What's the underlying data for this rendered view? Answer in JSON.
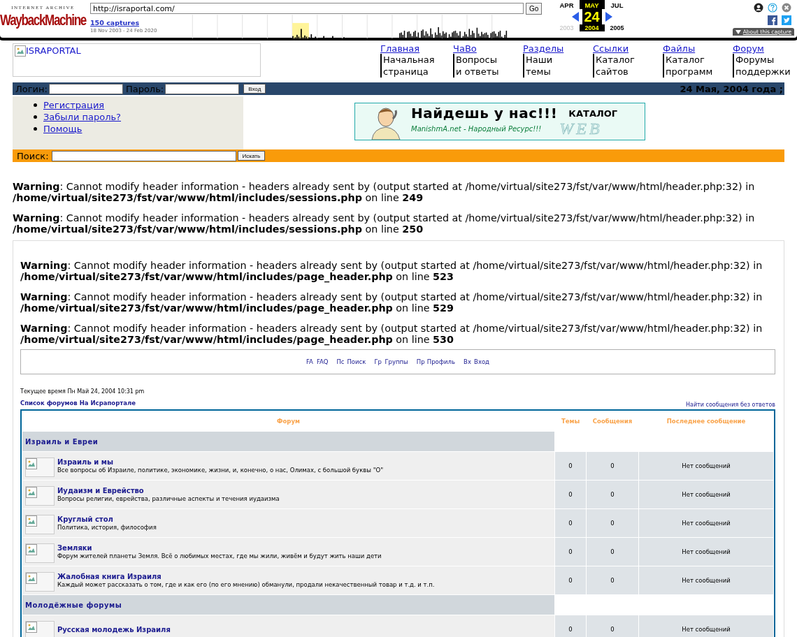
{
  "wayback": {
    "logo_top": "INTERNET ARCHIVE",
    "logo_main": "WaybackMachine",
    "url": "http://israportal.com/",
    "go": "Go",
    "captures": "150 captures",
    "date_range": "18 Nov 2003 - 24 Feb 2020",
    "months": [
      {
        "label": "APR",
        "selected": false
      },
      {
        "label": "MAY",
        "selected": true
      },
      {
        "label": "JUL",
        "selected": false
      }
    ],
    "day": "24",
    "years": [
      {
        "label": "2003",
        "selected": false
      },
      {
        "label": "2004",
        "selected": true
      },
      {
        "label": "2005",
        "selected": false
      }
    ],
    "about": "About this capture"
  },
  "header": {
    "logo_alt": "ISRAPORTAL",
    "nav": [
      {
        "title": "Главная",
        "subtitle": "Начальная страница"
      },
      {
        "title": "ЧаВо",
        "subtitle": "Вопросы и ответы"
      },
      {
        "title": "Разделы",
        "subtitle": "Наши темы"
      },
      {
        "title": "Ссылки",
        "subtitle": "Каталог сайтов"
      },
      {
        "title": "Файлы",
        "subtitle": "Каталог программ"
      },
      {
        "title": "Форум",
        "subtitle": "Форумы поддержки"
      }
    ]
  },
  "login": {
    "login_label": "Логин:",
    "password_label": "Пароль:",
    "submit": "Вход",
    "date": "24 Мая, 2004 года ;"
  },
  "side_links": [
    "Регистрация",
    "Забыли пароль?",
    "Помощь"
  ],
  "banner": {
    "headline": "Найдешь у нас!!!",
    "catalog": "КАТАЛОГ",
    "web": "WEB",
    "subtitle": "ManishmA.net - Народный Ресурс!!!"
  },
  "search": {
    "label": "Поиск:",
    "button": "Искать"
  },
  "warnings": [
    "**Warning**: Cannot modify header information - headers already sent by (output started at /home/virtual/site273/fst/var/www/html/header.php:32) in **/home/virtual/site273/fst/var/www/html/includes/sessions.php** on line **249**",
    "**Warning**: Cannot modify header information - headers already sent by (output started at /home/virtual/site273/fst/var/www/html/header.php:32) in **/home/virtual/site273/fst/var/www/html/includes/sessions.php** on line **250**"
  ],
  "forum_page": {
    "warnings": [
      "**Warning**: Cannot modify header information - headers already sent by (output started at /home/virtual/site273/fst/var/www/html/header.php:32) in **/home/virtual/site273/fst/var/www/html/includes/page_header.php** on line **523**",
      "**Warning**: Cannot modify header information - headers already sent by (output started at /home/virtual/site273/fst/var/www/html/header.php:32) in **/home/virtual/site273/fst/var/www/html/includes/page_header.php** on line **529**",
      "**Warning**: Cannot modify header information - headers already sent by (output started at /home/virtual/site273/fst/var/www/html/header.php:32) in **/home/virtual/site273/fst/var/www/html/includes/page_header.php** on line **530**"
    ],
    "nav": [
      {
        "icon_alt": "FA",
        "label": "FAQ"
      },
      {
        "icon_alt": "Пс",
        "label": "Поиск"
      },
      {
        "icon_alt": "Гр",
        "label": "Группы"
      },
      {
        "icon_alt": "Пр",
        "label": "Профиль"
      },
      {
        "icon_alt": "Вх",
        "label": "Вход"
      }
    ],
    "current_time": "Текущее время Пн Май 24, 2004 10:31 pm",
    "breadcrumb": "Список форумов На Исрапортале",
    "unanswered": "Найти сообщения без ответов",
    "table": {
      "columns": [
        "Форум",
        "Темы",
        "Сообщения",
        "Последнее сообщение"
      ],
      "sections": [
        {
          "title": "Израиль и Евреи",
          "forums": [
            {
              "title": "Израиль и мы",
              "description": "Все вопросы об Израиле, политике, экономике, жизни, и, конечно, о нас, Олимах, с большой буквы \"О\"",
              "topics": "0",
              "posts": "0",
              "last": "Нет сообщений"
            },
            {
              "title": "Иудаизм и Еврейство",
              "description": "Вопросы религии, еврейства, различные аспекты и течения иудаизма",
              "topics": "0",
              "posts": "0",
              "last": "Нет сообщений"
            },
            {
              "title": "Круглый стол",
              "description": "Политика, история, философия",
              "topics": "0",
              "posts": "0",
              "last": "Нет сообщений"
            },
            {
              "title": "Земляки",
              "description": "Форум жителей планеты Земля. Всё о любимых местах, где мы жили, живём и будут жить наши дети",
              "topics": "0",
              "posts": "0",
              "last": "Нет сообщений"
            },
            {
              "title": "Жалобная книга Израиля",
              "description": "Каждый может рассказать о том, где и как его (по его мнению) обманули, продали некачественный товар и т.д. и т.п.",
              "topics": "0",
              "posts": "0",
              "last": "Нет сообщений"
            }
          ]
        },
        {
          "title": "Молодёжные форумы",
          "forums": [
            {
              "title": "Русская молодежь Израиля",
              "topics": "0",
              "posts": "0",
              "last": "Нет сообщений"
            }
          ]
        }
      ]
    }
  }
}
